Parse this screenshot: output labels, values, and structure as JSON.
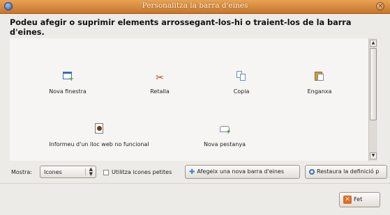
{
  "window": {
    "title": "Personalitza la barra d'eines",
    "close_glyph": "×"
  },
  "instructions": "Podeu afegir o suprimir elements arrossegant-los-hi o traient-los de la barra d'eines.",
  "palette": {
    "items": [
      {
        "label": "Nova finestra",
        "icon": "new-window-icon"
      },
      {
        "label": "Retalla",
        "icon": "cut-icon"
      },
      {
        "label": "Copia",
        "icon": "copy-icon"
      },
      {
        "label": "Enganxa",
        "icon": "paste-icon"
      },
      {
        "label": "Informeu d'un lloc web no funcional",
        "icon": "report-broken-site-icon"
      },
      {
        "label": "Nova pestanya",
        "icon": "new-tab-icon"
      }
    ]
  },
  "controls": {
    "show_label": "Mostra:",
    "show_value": "Icones",
    "small_icons_label": "Utilitza icones petites",
    "small_icons_checked": false,
    "add_toolbar_label": "Afegeix una nova barra d'eines",
    "restore_label": "Restaura la definició p",
    "done_label": "Fet"
  },
  "colors": {
    "titlebar": "#d88a3d",
    "window_bg": "#edebe7",
    "palette_bg": "#f6f5f3"
  }
}
